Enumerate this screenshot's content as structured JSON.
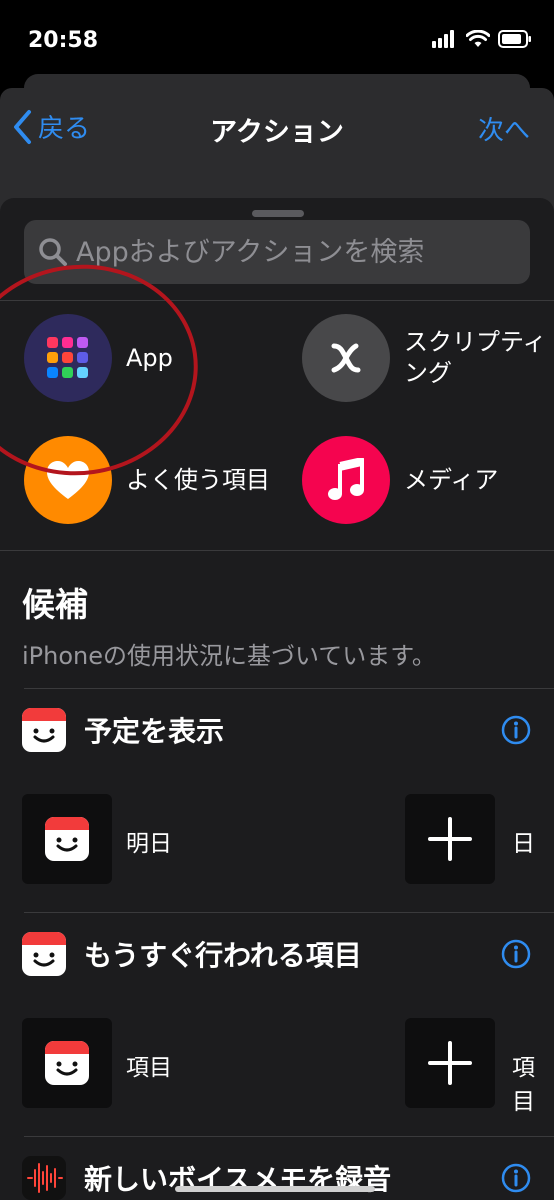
{
  "status_bar": {
    "time": "20:58"
  },
  "nav": {
    "back_label": "戻る",
    "title": "アクション",
    "next_label": "次へ"
  },
  "search": {
    "placeholder": "Appおよびアクションを検索"
  },
  "categories": [
    {
      "label": "App",
      "icon": "app-grid-icon",
      "color": "#2e2a5c"
    },
    {
      "label": "スクリプティ\nング",
      "icon": "script-x-icon",
      "color": "#48484a"
    },
    {
      "label": "よく使う項目",
      "icon": "heart-icon",
      "color": "#ff8a00"
    },
    {
      "label": "メディア",
      "icon": "music-note-icon",
      "color": "#f5044f"
    }
  ],
  "suggestions": {
    "title": "候補",
    "subtitle": "iPhoneの使用状況に基づいています。",
    "actions": [
      {
        "title": "予定を表示",
        "icon": "calendar-face-icon",
        "param_labels": [
          "明日",
          "日"
        ]
      },
      {
        "title": "もうすぐ行われる項目",
        "icon": "calendar-face-icon",
        "param_labels": [
          "項目",
          "項目"
        ]
      },
      {
        "title": "新しいボイスメモを録音",
        "icon": "voice-memo-icon"
      }
    ]
  },
  "colors": {
    "accent": "#2f8cf0",
    "sheet": "#1c1c1e",
    "annotation_ring": "#b3151d"
  }
}
